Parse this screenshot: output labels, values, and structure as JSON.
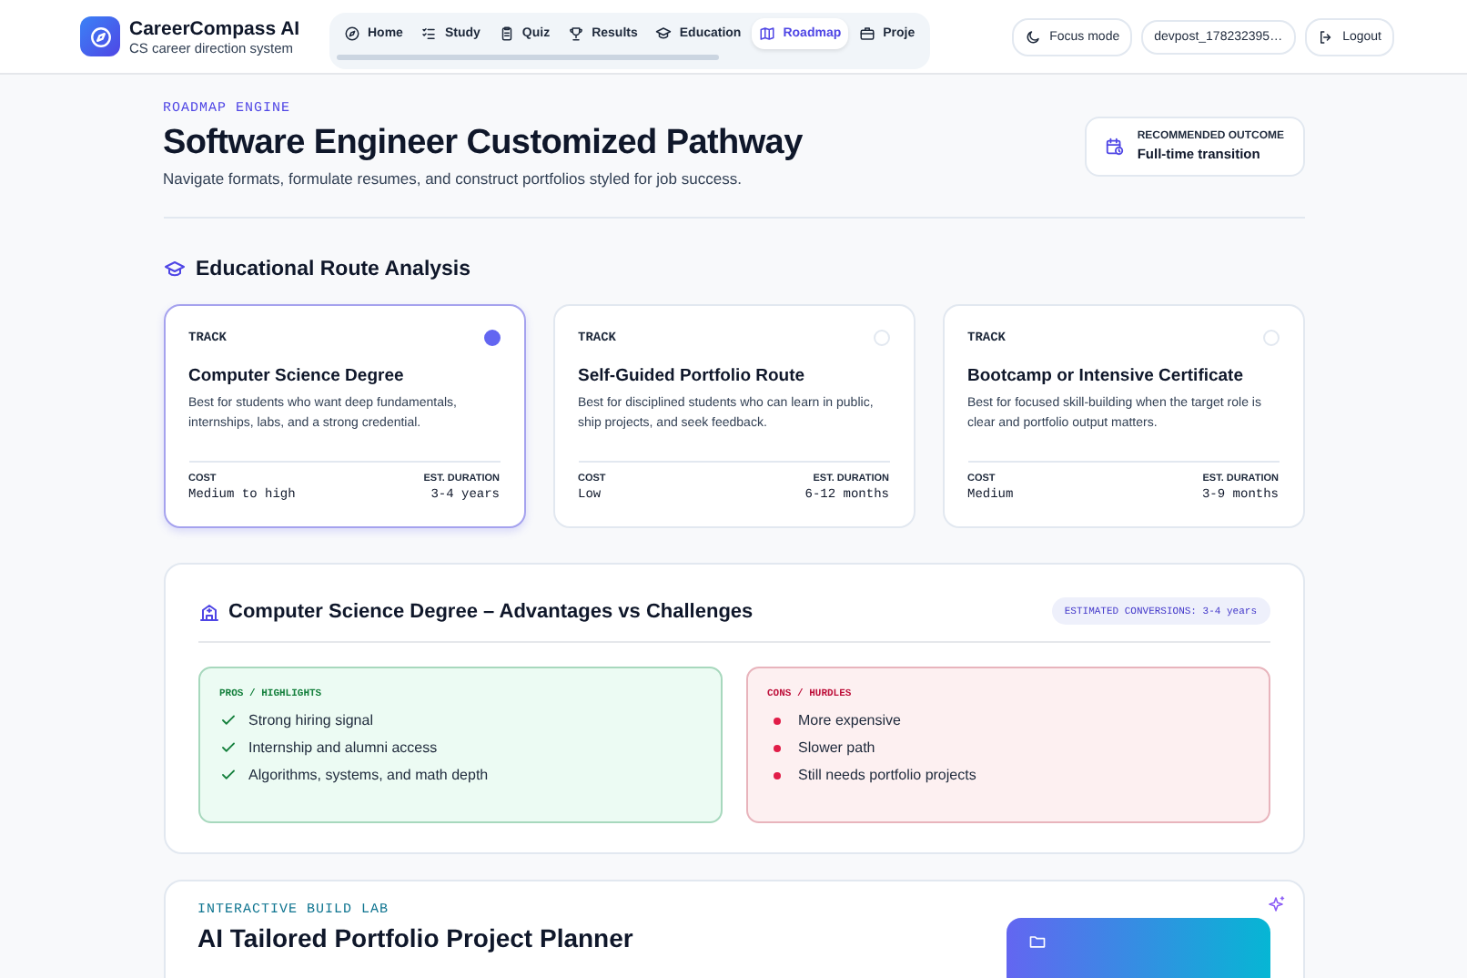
{
  "app": {
    "name": "CareerCompass AI",
    "tagline": "CS career direction system"
  },
  "nav": [
    {
      "label": "Home",
      "selected": false
    },
    {
      "label": "Study",
      "selected": false
    },
    {
      "label": "Quiz",
      "selected": false
    },
    {
      "label": "Results",
      "selected": false
    },
    {
      "label": "Education",
      "selected": false
    },
    {
      "label": "Roadmap",
      "selected": true
    },
    {
      "label": "Proje",
      "selected": false
    }
  ],
  "header_actions": {
    "focus": "Focus mode",
    "user": "devpost_178232395…",
    "logout": "Logout"
  },
  "hero": {
    "eyebrow": "ROADMAP ENGINE",
    "title": "Software Engineer Customized Pathway",
    "subtitle": "Navigate formats, formulate resumes, and construct portfolios styled for job success.",
    "outcome_label": "RECOMMENDED OUTCOME",
    "outcome_value": "Full-time transition"
  },
  "routes": {
    "heading": "Educational Route Analysis",
    "tracks": [
      {
        "tag": "TRACK",
        "title": "Computer Science Degree",
        "description": "Best for students who want deep fundamentals, internships, labs, and a strong credential.",
        "cost_label": "COST",
        "cost": "Medium to high",
        "duration_label": "EST. DURATION",
        "duration": "3-4 years",
        "selected": true
      },
      {
        "tag": "TRACK",
        "title": "Self-Guided Portfolio Route",
        "description": "Best for disciplined students who can learn in public, ship projects, and seek feedback.",
        "cost_label": "COST",
        "cost": "Low",
        "duration_label": "EST. DURATION",
        "duration": "6-12 months",
        "selected": false
      },
      {
        "tag": "TRACK",
        "title": "Bootcamp or Intensive Certificate",
        "description": "Best for focused skill-building when the target role is clear and portfolio output matters.",
        "cost_label": "COST",
        "cost": "Medium",
        "duration_label": "EST. DURATION",
        "duration": "3-9 months",
        "selected": false
      }
    ]
  },
  "comparison": {
    "title": "Computer Science Degree – Advantages vs Challenges",
    "badge": "ESTIMATED CONVERSIONS: 3-4 years",
    "pros": {
      "label": "PROS / HIGHLIGHTS",
      "items": [
        "Strong hiring signal",
        "Internship and alumni access",
        "Algorithms, systems, and math depth"
      ]
    },
    "cons": {
      "label": "CONS / HURDLES",
      "items": [
        "More expensive",
        "Slower path",
        "Still needs portfolio projects"
      ]
    }
  },
  "build_lab": {
    "eyebrow": "INTERACTIVE BUILD LAB",
    "title": "AI Tailored Portfolio Project Planner"
  }
}
